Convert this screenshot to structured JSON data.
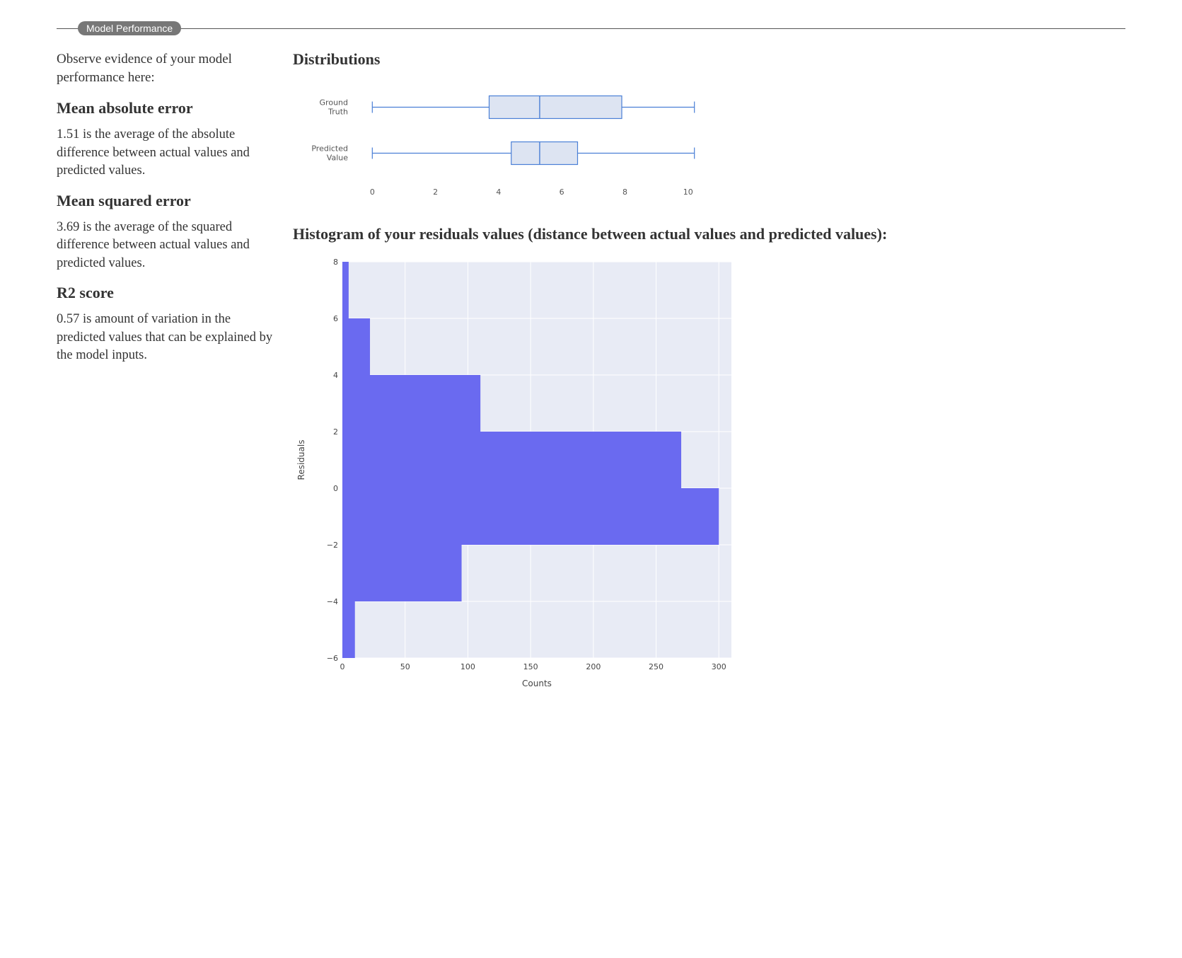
{
  "panel": {
    "title": "Model Performance"
  },
  "intro": "Observe evidence of your model performance here:",
  "metrics": {
    "mae": {
      "heading": "Mean absolute error",
      "text": "1.51 is the average of the absolute difference between actual values and predicted values."
    },
    "mse": {
      "heading": "Mean squared error",
      "text": "3.69 is the average of the squared difference between actual values and predicted values."
    },
    "r2": {
      "heading": "R2 score",
      "text": "0.57 is amount of variation in the predicted values that can be explained by the model inputs."
    }
  },
  "distributions": {
    "heading": "Distributions"
  },
  "histogram": {
    "heading": "Histogram of your residuals values (distance between actual values and predicted values):"
  },
  "chart_data": [
    {
      "type": "boxplot",
      "title": "Distributions",
      "categories": [
        "Ground Truth",
        "Predicted Value"
      ],
      "series": [
        {
          "name": "Ground Truth",
          "min": 0,
          "q1": 3.7,
          "median": 5.3,
          "q3": 7.9,
          "max": 10.2
        },
        {
          "name": "Predicted Value",
          "min": 0,
          "q1": 4.4,
          "median": 5.3,
          "q3": 6.5,
          "max": 10.2
        }
      ],
      "xticks": [
        0,
        2,
        4,
        6,
        8,
        10
      ],
      "xlim": [
        -0.5,
        10.7
      ],
      "xlabel": "",
      "ylabel": ""
    },
    {
      "type": "bar",
      "orientation": "horizontal",
      "title": "Histogram of your residuals values (distance between actual values and predicted values):",
      "xlabel": "Counts",
      "ylabel": "Residuals",
      "xlim": [
        0,
        310
      ],
      "ylim": [
        -6,
        8
      ],
      "xticks": [
        0,
        50,
        100,
        150,
        200,
        250,
        300
      ],
      "yticks": [
        -6,
        -4,
        -2,
        0,
        2,
        4,
        6,
        8
      ],
      "bars": [
        {
          "y_low": -6,
          "y_high": -4,
          "count": 10
        },
        {
          "y_low": -4,
          "y_high": -2,
          "count": 95
        },
        {
          "y_low": -2,
          "y_high": 0,
          "count": 300
        },
        {
          "y_low": 0,
          "y_high": 2,
          "count": 270
        },
        {
          "y_low": 2,
          "y_high": 4,
          "count": 110
        },
        {
          "y_low": 4,
          "y_high": 6,
          "count": 22
        },
        {
          "y_low": 6,
          "y_high": 8,
          "count": 5
        }
      ]
    }
  ]
}
